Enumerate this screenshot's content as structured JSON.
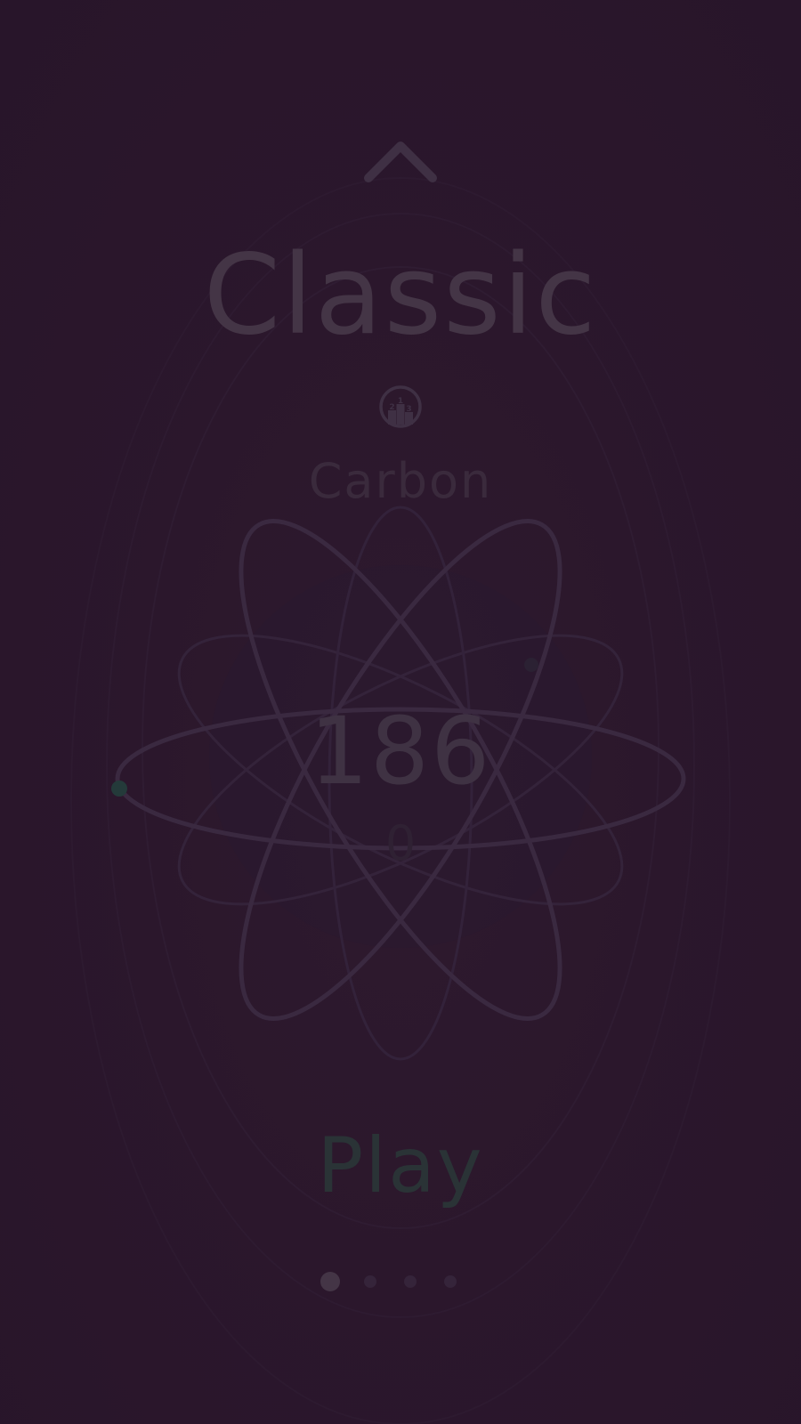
{
  "screen": {
    "mode_title": "Classic",
    "element_name": "Carbon",
    "score": "186",
    "score_sub": "0",
    "play_label": "Play"
  },
  "pagination": {
    "total_pages": 4,
    "active_index": 0
  },
  "icons": {
    "up": "chevron-up-icon",
    "leaderboard": "leaderboard-podium-icon",
    "podium_labels": [
      "2",
      "1",
      "3"
    ]
  },
  "colors": {
    "background": "#2a172b",
    "title_text": "#443546",
    "subtitle_text": "#3a2a3c",
    "orbit_stroke": "#3a2940",
    "electron": "#243a3a",
    "play_text": "#2a3336",
    "dot_active": "#443546",
    "dot_inactive": "#35243a"
  }
}
